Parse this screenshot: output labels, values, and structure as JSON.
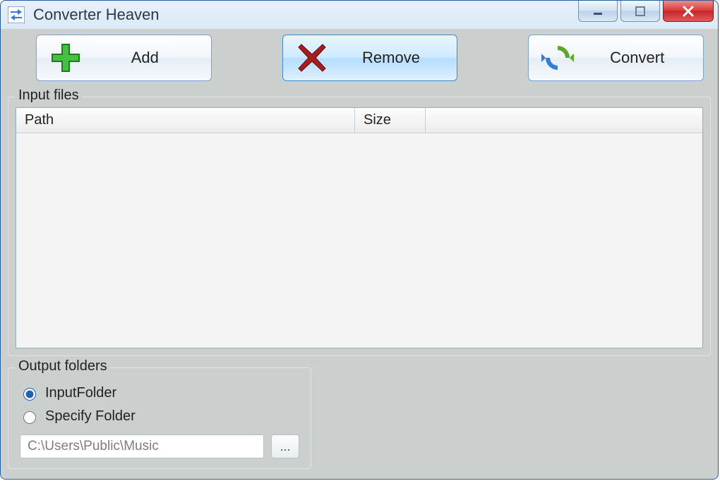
{
  "window": {
    "title": "Converter Heaven"
  },
  "toolbar": {
    "add": {
      "label": "Add"
    },
    "remove": {
      "label": "Remove"
    },
    "convert": {
      "label": "Convert"
    }
  },
  "input_files": {
    "legend": "Input files",
    "columns": {
      "path": "Path",
      "size": "Size"
    },
    "rows": []
  },
  "output": {
    "legend": "Output folders",
    "radio_input_folder": {
      "label": "InputFolder",
      "checked": true
    },
    "radio_specify": {
      "label": "Specify Folder",
      "checked": false
    },
    "path_value": "C:\\Users\\Public\\Music",
    "browse_label": "..."
  }
}
